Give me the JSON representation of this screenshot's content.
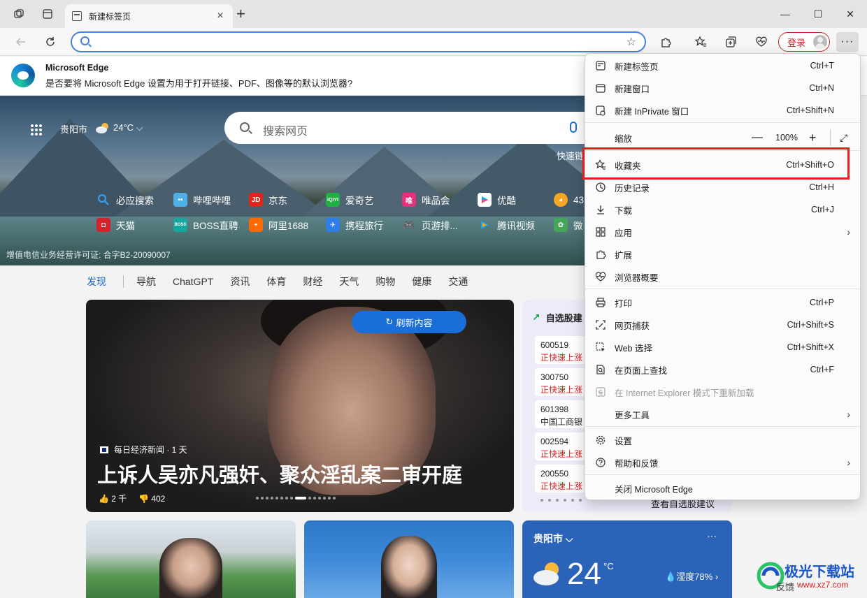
{
  "tab": {
    "title": "新建标签页",
    "close": "×",
    "new": "+"
  },
  "window": {
    "minimize": "—",
    "maximize": "☐",
    "close": "✕"
  },
  "toolbar": {
    "address_value": "",
    "address_placeholder": "",
    "login_label": "登录",
    "more_label": "···"
  },
  "infobar": {
    "title": "Microsoft Edge",
    "message": "是否要将 Microsoft Edge 设置为用于打开链接、PDF、图像等的默认浏览器?"
  },
  "hero": {
    "city": "贵阳市",
    "temperature": "24°C",
    "search_placeholder": "搜索网页",
    "quick_label": "快速链",
    "license": "增值电信业务经营许可证: 合字B2-20090007",
    "quick_links_row1": [
      "必应搜索",
      "哔哩哔哩",
      "京东",
      "爱奇艺",
      "唯品会",
      "优酷",
      "43"
    ],
    "quick_links_row2": [
      "天猫",
      "BOSS直聘",
      "阿里1688",
      "携程旅行",
      "页游排...",
      "腾讯视频",
      "微"
    ]
  },
  "nav": {
    "items": [
      "发现",
      "导航",
      "ChatGPT",
      "资讯",
      "体育",
      "财经",
      "天气",
      "购物",
      "健康",
      "交通"
    ]
  },
  "main_card": {
    "refresh_label": "刷新内容",
    "source": "每日经济新闻 · 1 天",
    "headline": "上诉人吴亦凡强奸、聚众淫乱案二审开庭",
    "likes": "2 千",
    "dislikes": "402"
  },
  "stocks": {
    "title": "自选股建",
    "rows": [
      {
        "code": "600519",
        "status": "正快速上涨"
      },
      {
        "code": "300750",
        "status": "正快速上涨"
      },
      {
        "code": "601398",
        "status": "中国工商银"
      },
      {
        "code": "002594",
        "status": "正快速上涨"
      },
      {
        "code": "200550",
        "status": "正快速上涨"
      }
    ],
    "footer": "查看自选股建议"
  },
  "weather": {
    "city": "贵阳市",
    "more": "···",
    "temp": "24",
    "unit": "°C",
    "humidity": "湿度78%"
  },
  "feedback": "反馈",
  "watermark": {
    "name": "极光下载站",
    "url": "www.xz7.com"
  },
  "menu": {
    "items": [
      {
        "label": "新建标签页",
        "shortcut": "Ctrl+T"
      },
      {
        "label": "新建窗口",
        "shortcut": "Ctrl+N"
      },
      {
        "label": "新建 InPrivate 窗口",
        "shortcut": "Ctrl+Shift+N"
      },
      {
        "label": "缩放",
        "shortcut": ""
      },
      {
        "label": "收藏夹",
        "shortcut": "Ctrl+Shift+O"
      },
      {
        "label": "历史记录",
        "shortcut": "Ctrl+H"
      },
      {
        "label": "下载",
        "shortcut": "Ctrl+J"
      },
      {
        "label": "应用",
        "shortcut": ""
      },
      {
        "label": "扩展",
        "shortcut": ""
      },
      {
        "label": "浏览器概要",
        "shortcut": ""
      },
      {
        "label": "打印",
        "shortcut": "Ctrl+P"
      },
      {
        "label": "网页捕获",
        "shortcut": "Ctrl+Shift+S"
      },
      {
        "label": "Web 选择",
        "shortcut": "Ctrl+Shift+X"
      },
      {
        "label": "在页面上查找",
        "shortcut": "Ctrl+F"
      },
      {
        "label": "在 Internet Explorer 模式下重新加载",
        "shortcut": ""
      },
      {
        "label": "更多工具",
        "shortcut": ""
      },
      {
        "label": "设置",
        "shortcut": ""
      },
      {
        "label": "帮助和反馈",
        "shortcut": ""
      },
      {
        "label": "关闭 Microsoft Edge",
        "shortcut": ""
      }
    ],
    "zoom": {
      "minus": "—",
      "value": "100%",
      "plus": "+"
    }
  },
  "colors": {
    "accent": "#1a6ed8",
    "highlight": "#e0201e",
    "login": "#c62828"
  }
}
